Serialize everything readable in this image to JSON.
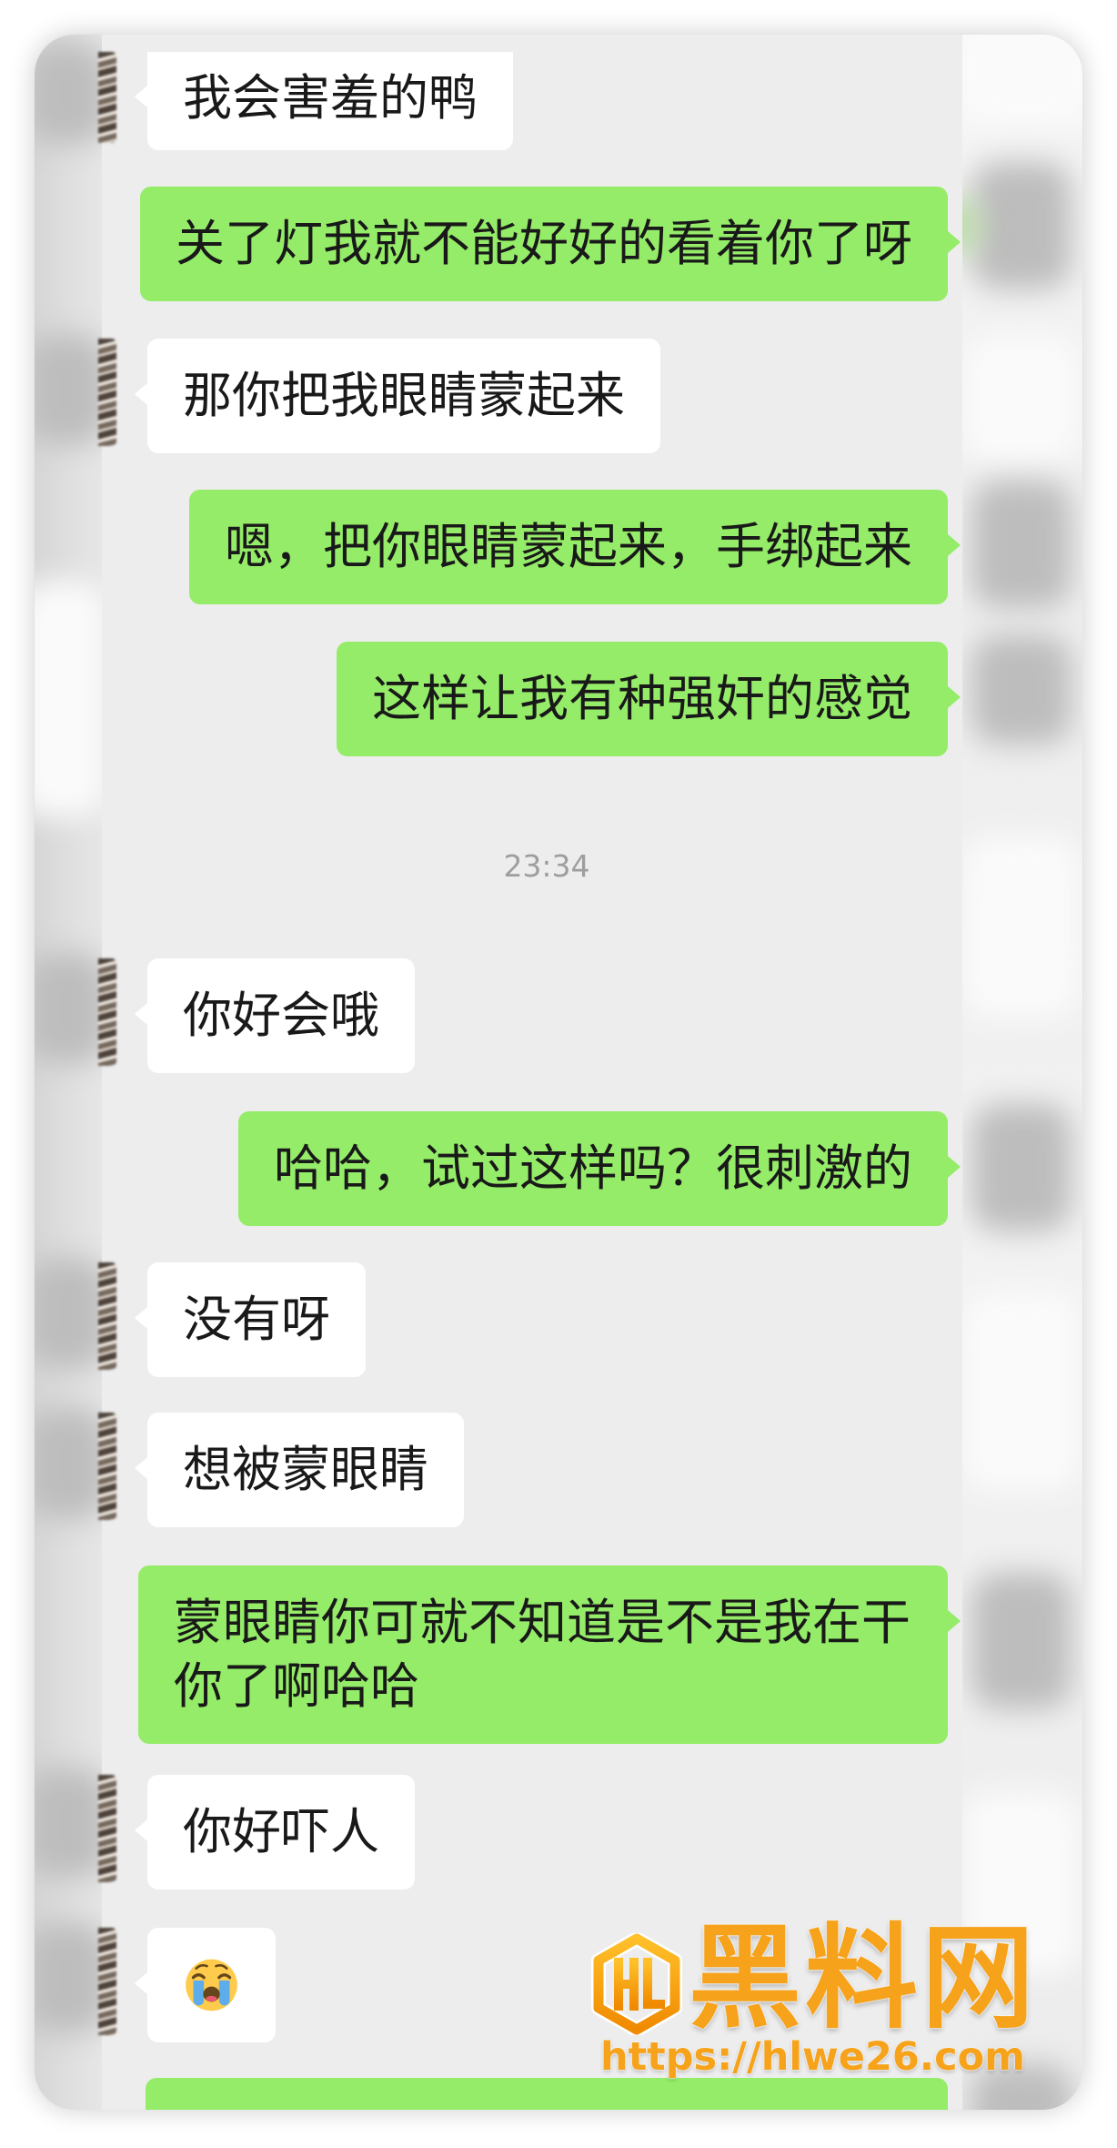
{
  "chat": {
    "messages": [
      {
        "outgoing": false,
        "text": "我会害羞的鸭"
      },
      {
        "outgoing": true,
        "text": "关了灯我就不能好好的看着你了呀"
      },
      {
        "outgoing": false,
        "text": "那你把我眼睛蒙起来"
      },
      {
        "outgoing": true,
        "text": "嗯，把你眼睛蒙起来，手绑起来"
      },
      {
        "outgoing": true,
        "text": "这样让我有种强奸的感觉"
      },
      {
        "outgoing": false,
        "text": "你好会哦"
      },
      {
        "outgoing": true,
        "text": "哈哈，试过这样吗？很刺激的"
      },
      {
        "outgoing": false,
        "text": "没有呀"
      },
      {
        "outgoing": false,
        "text": "想被蒙眼睛"
      },
      {
        "outgoing": true,
        "text": "蒙眼睛你可就不知道是不是我在干你了啊哈哈"
      },
      {
        "outgoing": false,
        "text": "你好吓人"
      },
      {
        "outgoing": false,
        "icon": "loudly-crying-face-icon"
      },
      {
        "outgoing": true
      }
    ],
    "timestamp": "23:34"
  },
  "colors": {
    "background": "#ededed",
    "incoming_bubble": "#ffffff",
    "outgoing_bubble": "#95ec69",
    "text": "#191919",
    "timestamp": "#9e9e9e",
    "watermark": "#f6a21a"
  },
  "watermark": {
    "icon": "hl-shield-logo-icon",
    "brand": "黑料网",
    "url": "https://hlwe26.com"
  }
}
